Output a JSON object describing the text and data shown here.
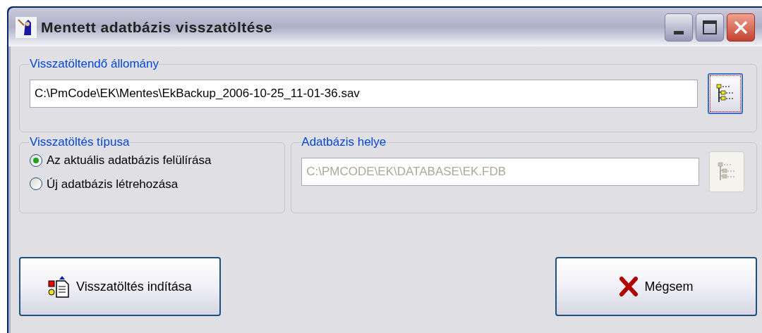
{
  "window": {
    "title": "Mentett adatbázis visszatöltése"
  },
  "source": {
    "label": "Visszatöltendő állomány",
    "value": "C:\\PmCode\\EK\\Mentes\\EkBackup_2006-10-25_11-01-36.sav",
    "browse_focused": true
  },
  "restore_type": {
    "label": "Visszatöltés típusa",
    "options": [
      {
        "label": "Az aktuális adatbázis felülírása",
        "selected": true
      },
      {
        "label": "Új adatbázis létrehozása",
        "selected": false
      }
    ]
  },
  "db_location": {
    "label": "Adatbázis helye",
    "value": "C:\\PMCODE\\EK\\DATABASE\\EK.FDB",
    "disabled": true
  },
  "buttons": [
    {
      "label": "Visszatöltés indítása",
      "kind": "start"
    },
    {
      "label": "Mégsem",
      "kind": "cancel"
    }
  ]
}
